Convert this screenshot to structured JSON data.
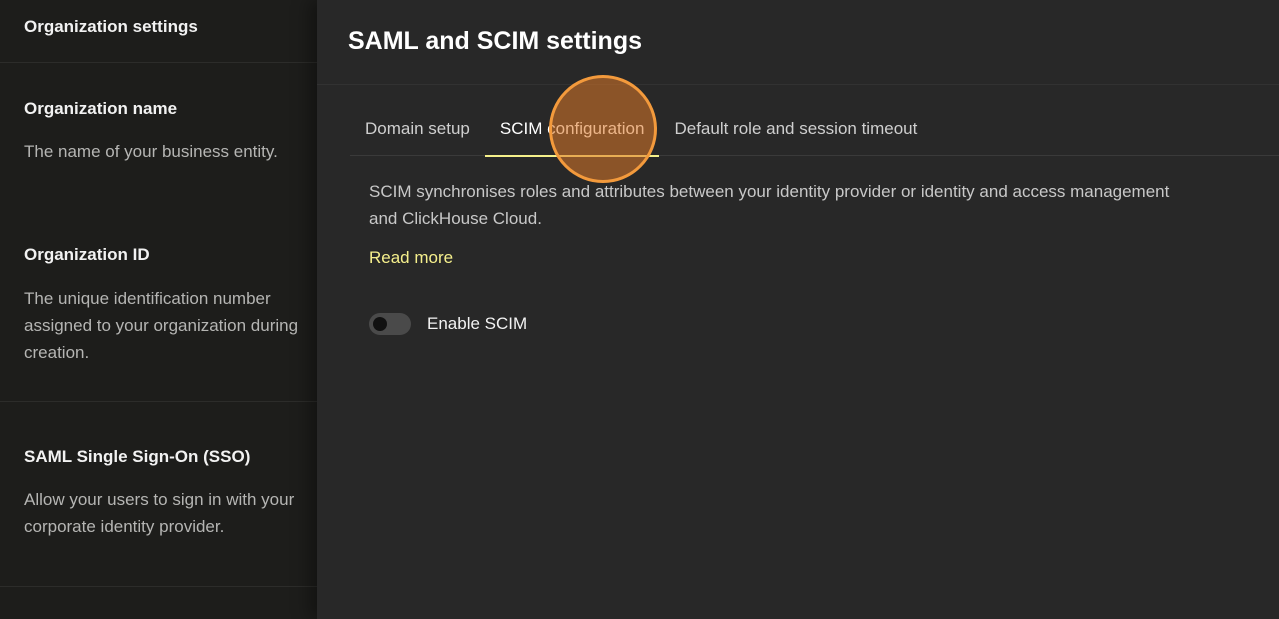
{
  "background_page": {
    "header": "Organization settings",
    "sections": [
      {
        "title": "Organization name",
        "lines": [
          "The name of your business entity."
        ]
      },
      {
        "title": "Organization ID",
        "lines": [
          "The unique identification number",
          "assigned to your organization during",
          "creation."
        ]
      },
      {
        "title": "SAML Single Sign-On (SSO)",
        "lines": [
          "Allow your users to sign in with your",
          "corporate identity provider."
        ]
      }
    ]
  },
  "panel": {
    "title": "SAML and SCIM settings",
    "tabs": [
      {
        "label": "Domain setup"
      },
      {
        "label": "SCIM configuration"
      },
      {
        "label": "Default role and session timeout"
      }
    ],
    "active_tab": "SCIM configuration",
    "description_lines": [
      "SCIM synchronises roles and attributes between your identity provider or identity and access management",
      "and ClickHouse Cloud."
    ],
    "read_more": "Read more",
    "toggle": {
      "label": "Enable SCIM",
      "enabled": false
    }
  },
  "colors": {
    "accent": "#f5ef8c",
    "click_marker": "#f39a3c"
  }
}
